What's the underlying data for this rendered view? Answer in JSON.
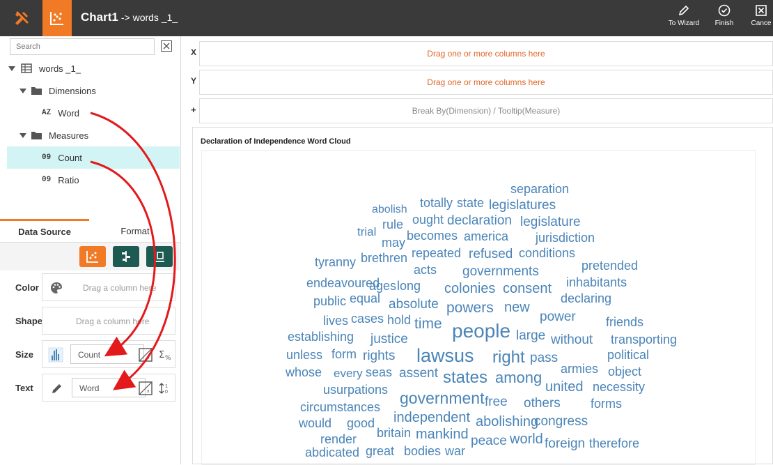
{
  "header": {
    "title": "Chart1",
    "subtitle": "-> words _1_",
    "actions": [
      {
        "label": "To Wizard",
        "icon": "pencil-icon"
      },
      {
        "label": "Finish",
        "icon": "check-circle-icon"
      },
      {
        "label": "Cance",
        "icon": "close-box-icon"
      }
    ]
  },
  "sidebar": {
    "search_placeholder": "Search",
    "tree": {
      "dataset": "words _1_",
      "dimensions_label": "Dimensions",
      "dimensions": [
        {
          "type": "AZ",
          "name": "Word"
        }
      ],
      "measures_label": "Measures",
      "measures": [
        {
          "type": "09",
          "name": "Count"
        },
        {
          "type": "09",
          "name": "Ratio"
        }
      ]
    },
    "tabs": [
      "Data Source",
      "Format"
    ],
    "properties": {
      "color_label": "Color",
      "color_drop": "Drag a column here",
      "shape_label": "Shape",
      "shape_drop": "Drag a column here",
      "size_label": "Size",
      "size_field": "Count",
      "text_label": "Text",
      "text_field": "Word"
    }
  },
  "axes": {
    "x_label": "X",
    "x_drop": "Drag one or more columns here",
    "y_label": "Y",
    "y_drop": "Drag one or more columns here",
    "break_label": "+",
    "break_drop": "Break By(Dimension) / Tooltip(Measure)"
  },
  "chart": {
    "title": "Declaration of Independence Word Cloud",
    "word_color": "#4a84b8",
    "words": [
      {
        "t": "separation",
        "s": 18
      },
      {
        "t": "abolish",
        "s": 16
      },
      {
        "t": "totally",
        "s": 18
      },
      {
        "t": "state",
        "s": 18
      },
      {
        "t": "legislatures",
        "s": 19
      },
      {
        "t": "rule",
        "s": 18
      },
      {
        "t": "ought",
        "s": 18
      },
      {
        "t": "declaration",
        "s": 19
      },
      {
        "t": "legislature",
        "s": 19
      },
      {
        "t": "trial",
        "s": 17
      },
      {
        "t": "may",
        "s": 18
      },
      {
        "t": "becomes",
        "s": 18
      },
      {
        "t": "america",
        "s": 18
      },
      {
        "t": "jurisdiction",
        "s": 18
      },
      {
        "t": "brethren",
        "s": 18
      },
      {
        "t": "repeated",
        "s": 18
      },
      {
        "t": "refused",
        "s": 19
      },
      {
        "t": "conditions",
        "s": 18
      },
      {
        "t": "tyranny",
        "s": 18
      },
      {
        "t": "pretended",
        "s": 18
      },
      {
        "t": "acts",
        "s": 18
      },
      {
        "t": "governments",
        "s": 19
      },
      {
        "t": "endeavoured",
        "s": 18
      },
      {
        "t": "ages",
        "s": 18
      },
      {
        "t": "long",
        "s": 18
      },
      {
        "t": "colonies",
        "s": 20
      },
      {
        "t": "consent",
        "s": 20
      },
      {
        "t": "inhabitants",
        "s": 18
      },
      {
        "t": "public",
        "s": 18
      },
      {
        "t": "equal",
        "s": 18
      },
      {
        "t": "absolute",
        "s": 19
      },
      {
        "t": "powers",
        "s": 21
      },
      {
        "t": "new",
        "s": 20
      },
      {
        "t": "declaring",
        "s": 18
      },
      {
        "t": "lives",
        "s": 18
      },
      {
        "t": "cases",
        "s": 18
      },
      {
        "t": "hold",
        "s": 18
      },
      {
        "t": "time",
        "s": 21
      },
      {
        "t": "people",
        "s": 28
      },
      {
        "t": "power",
        "s": 19
      },
      {
        "t": "friends",
        "s": 18
      },
      {
        "t": "establishing",
        "s": 18
      },
      {
        "t": "justice",
        "s": 19
      },
      {
        "t": "large",
        "s": 19
      },
      {
        "t": "without",
        "s": 19
      },
      {
        "t": "transporting",
        "s": 18
      },
      {
        "t": "unless",
        "s": 18
      },
      {
        "t": "form",
        "s": 18
      },
      {
        "t": "rights",
        "s": 19
      },
      {
        "t": "laws",
        "s": 27
      },
      {
        "t": "us",
        "s": 27
      },
      {
        "t": "right",
        "s": 24
      },
      {
        "t": "pass",
        "s": 19
      },
      {
        "t": "political",
        "s": 18
      },
      {
        "t": "whose",
        "s": 18
      },
      {
        "t": "every",
        "s": 17
      },
      {
        "t": "seas",
        "s": 18
      },
      {
        "t": "assent",
        "s": 19
      },
      {
        "t": "states",
        "s": 24
      },
      {
        "t": "among",
        "s": 22
      },
      {
        "t": "armies",
        "s": 18
      },
      {
        "t": "object",
        "s": 18
      },
      {
        "t": "usurpations",
        "s": 18
      },
      {
        "t": "united",
        "s": 20
      },
      {
        "t": "necessity",
        "s": 18
      },
      {
        "t": "government",
        "s": 23
      },
      {
        "t": "free",
        "s": 19
      },
      {
        "t": "others",
        "s": 19
      },
      {
        "t": "forms",
        "s": 18
      },
      {
        "t": "circumstances",
        "s": 18
      },
      {
        "t": "independent",
        "s": 20
      },
      {
        "t": "abolishing",
        "s": 20
      },
      {
        "t": "congress",
        "s": 19
      },
      {
        "t": "would",
        "s": 18
      },
      {
        "t": "good",
        "s": 18
      },
      {
        "t": "render",
        "s": 18
      },
      {
        "t": "britain",
        "s": 18
      },
      {
        "t": "mankind",
        "s": 20
      },
      {
        "t": "peace",
        "s": 19
      },
      {
        "t": "world",
        "s": 20
      },
      {
        "t": "foreign",
        "s": 19
      },
      {
        "t": "therefore",
        "s": 18
      },
      {
        "t": "abdicated",
        "s": 18
      },
      {
        "t": "great",
        "s": 18
      },
      {
        "t": "bodies",
        "s": 18
      },
      {
        "t": "war",
        "s": 18
      }
    ]
  }
}
